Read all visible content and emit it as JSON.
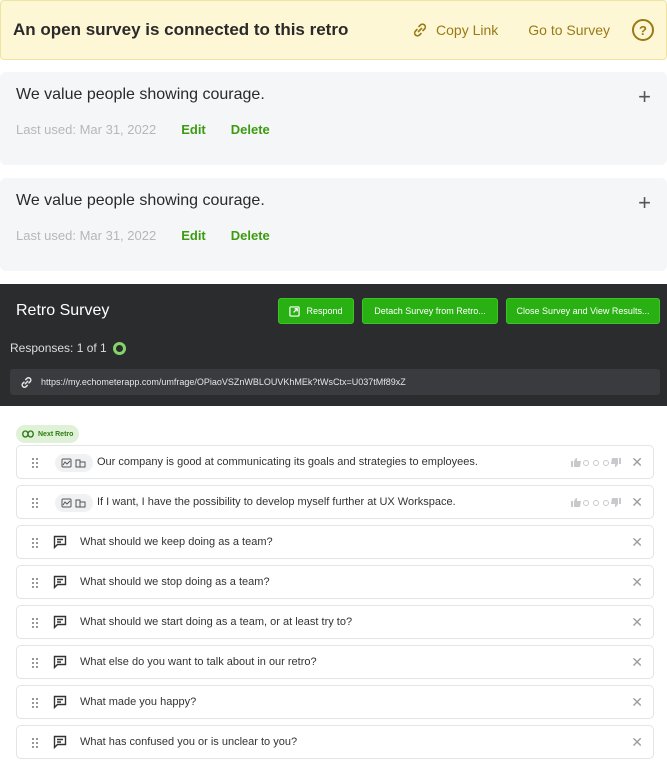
{
  "banner": {
    "title": "An open survey is connected to this retro",
    "copy_link": "Copy Link",
    "go_to_survey": "Go to Survey",
    "help": "?"
  },
  "values": [
    {
      "title": "We value people showing courage.",
      "last_used": "Last used: Mar 31, 2022",
      "edit": "Edit",
      "delete": "Delete"
    },
    {
      "title": "We value people showing courage.",
      "last_used": "Last used: Mar 31, 2022",
      "edit": "Edit",
      "delete": "Delete"
    }
  ],
  "survey": {
    "title": "Retro Survey",
    "respond": "Respond",
    "detach": "Detach Survey from Retro...",
    "close": "Close Survey and View Results...",
    "responses": "Responses: 1 of 1",
    "url": "https://my.echometerapp.com/umfrage/OPiaoVSZnWBLOUVKhMEk?tWsCtx=U037tMf89xZ"
  },
  "next_retro": "Next Retro",
  "questions": [
    {
      "text": "Our company is good at communicating its goals and strategies to employees.",
      "type": "rating"
    },
    {
      "text": "If I want, I have the possibility to develop myself further at UX Workspace.",
      "type": "rating"
    },
    {
      "text": "What should we keep doing as a team?",
      "type": "text"
    },
    {
      "text": "What should we stop doing as a team?",
      "type": "text"
    },
    {
      "text": "What should we start doing as a team, or at least try to?",
      "type": "text"
    },
    {
      "text": "What else do you want to talk about in our retro?",
      "type": "text"
    },
    {
      "text": "What made you happy?",
      "type": "text"
    },
    {
      "text": "What has confused you or is unclear to you?",
      "type": "text"
    }
  ],
  "colors": {
    "accent": "#3c9b10",
    "button": "#29b012",
    "banner_bg": "#fdf7d6",
    "banner_text": "#9a7a14",
    "panel_bg": "#2b2c2e"
  }
}
